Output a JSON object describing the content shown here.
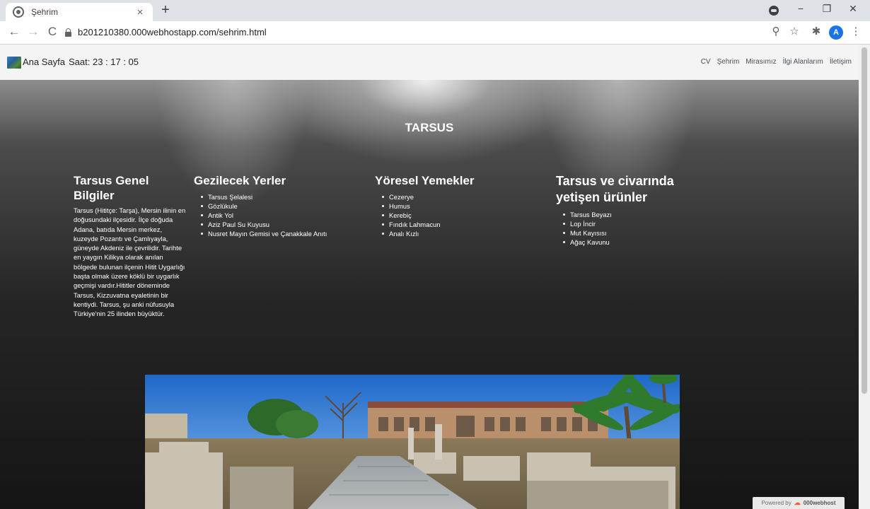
{
  "browser": {
    "tab_title": "Şehrim",
    "tab_close": "×",
    "new_tab": "+",
    "url": "b201210380.000webhostapp.com/sehrim.html",
    "back": "←",
    "forward": "→",
    "reload": "C",
    "minimize": "−",
    "restore": "❐",
    "close": "✕",
    "zoom_icon": "⚲",
    "star_icon": "☆",
    "extensions_icon": "✱",
    "menu_icon": "⋮",
    "avatar_letter": "A"
  },
  "navbar": {
    "brand": "Ana Sayfa",
    "clock": "Saat: 23 : 17 : 05",
    "links": [
      "CV",
      "Şehrim",
      "Mirasımız",
      "İlgi Alanlarım",
      "İletişim"
    ]
  },
  "hero": {
    "title": "TARSUS"
  },
  "sections": {
    "general": {
      "heading": "Tarsus Genel Bilgiler",
      "text": "Tarsus (Hititçe: Tarşa), Mersin ilinin en doğusundaki ilçesidir. İlçe doğuda Adana, batıda Mersin merkez, kuzeyde Pozantı ve Çamlıyayla, güneyde Akdeniz ile çevrilidir. Tarihte en yaygın Kilikya olarak anılan bölgede bulunan ilçenin Hitit Uygarlığı başta olmak üzere köklü bir uygarlık geçmişi vardır.Hititler döneminde Tarsus, Kizzuvatna eyaletinin bir kentiydi. Tarsus, şu anki nüfusuyla Türkiye'nin 25 ilinden büyüktür."
    },
    "places": {
      "heading": "Gezilecek Yerler",
      "items": [
        "Tarsus Şelalesi",
        "Gözlükule",
        "Antik Yol",
        "Aziz Paul Su Kuyusu",
        "Nusret Mayın Gemisi ve Çanakkale Anıtı"
      ]
    },
    "food": {
      "heading": "Yöresel Yemekler",
      "items": [
        "Cezerye",
        "Humus",
        "Kerebiç",
        "Fındık Lahmacun",
        "Analı Kızlı"
      ]
    },
    "products": {
      "heading": "Tarsus ve civarında yetişen ürünler",
      "items": [
        "Tarsus Beyazı",
        "Lop İncir",
        "Mut Kayısısı",
        "Ağaç Kavunu"
      ]
    }
  },
  "footer_badge": {
    "prefix": "Powered by",
    "brand": "000webhost"
  }
}
